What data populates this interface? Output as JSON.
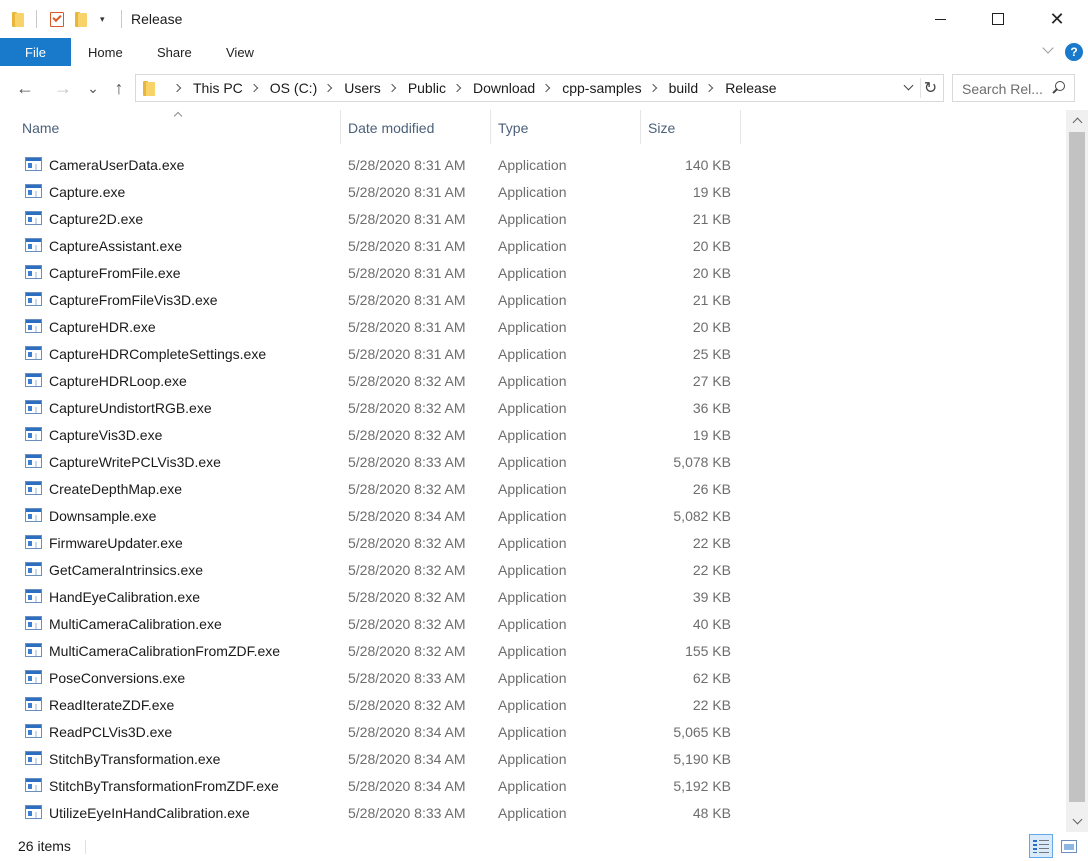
{
  "window": {
    "title": "Release"
  },
  "quick_access": {
    "icons": [
      "folder-icon",
      "properties-icon",
      "new-folder-icon",
      "customize-dropdown-icon"
    ],
    "dropdown_glyph": "▾"
  },
  "window_controls": {
    "close_glyph": "✕"
  },
  "ribbon": {
    "tabs": [
      {
        "label": "File"
      },
      {
        "label": "Home"
      },
      {
        "label": "Share"
      },
      {
        "label": "View"
      }
    ],
    "help_glyph": "?",
    "accent_color": "#1979ca"
  },
  "navigation": {
    "back_glyph": "←",
    "forward_glyph": "→",
    "recent_glyph": "⌄",
    "up_glyph": "↑",
    "breadcrumbs": [
      "This PC",
      "OS (C:)",
      "Users",
      "Public",
      "Download",
      "cpp-samples",
      "build",
      "Release"
    ],
    "refresh_glyph": "↻",
    "search_placeholder": "Search Rel..."
  },
  "columns": {
    "name": "Name",
    "date": "Date modified",
    "type": "Type",
    "size": "Size",
    "sorted_by": "Name"
  },
  "files": [
    {
      "name": "CameraUserData.exe",
      "date": "5/28/2020 8:31 AM",
      "type": "Application",
      "size": "140 KB"
    },
    {
      "name": "Capture.exe",
      "date": "5/28/2020 8:31 AM",
      "type": "Application",
      "size": "19 KB"
    },
    {
      "name": "Capture2D.exe",
      "date": "5/28/2020 8:31 AM",
      "type": "Application",
      "size": "21 KB"
    },
    {
      "name": "CaptureAssistant.exe",
      "date": "5/28/2020 8:31 AM",
      "type": "Application",
      "size": "20 KB"
    },
    {
      "name": "CaptureFromFile.exe",
      "date": "5/28/2020 8:31 AM",
      "type": "Application",
      "size": "20 KB"
    },
    {
      "name": "CaptureFromFileVis3D.exe",
      "date": "5/28/2020 8:31 AM",
      "type": "Application",
      "size": "21 KB"
    },
    {
      "name": "CaptureHDR.exe",
      "date": "5/28/2020 8:31 AM",
      "type": "Application",
      "size": "20 KB"
    },
    {
      "name": "CaptureHDRCompleteSettings.exe",
      "date": "5/28/2020 8:31 AM",
      "type": "Application",
      "size": "25 KB"
    },
    {
      "name": "CaptureHDRLoop.exe",
      "date": "5/28/2020 8:32 AM",
      "type": "Application",
      "size": "27 KB"
    },
    {
      "name": "CaptureUndistortRGB.exe",
      "date": "5/28/2020 8:32 AM",
      "type": "Application",
      "size": "36 KB"
    },
    {
      "name": "CaptureVis3D.exe",
      "date": "5/28/2020 8:32 AM",
      "type": "Application",
      "size": "19 KB"
    },
    {
      "name": "CaptureWritePCLVis3D.exe",
      "date": "5/28/2020 8:33 AM",
      "type": "Application",
      "size": "5,078 KB"
    },
    {
      "name": "CreateDepthMap.exe",
      "date": "5/28/2020 8:32 AM",
      "type": "Application",
      "size": "26 KB"
    },
    {
      "name": "Downsample.exe",
      "date": "5/28/2020 8:34 AM",
      "type": "Application",
      "size": "5,082 KB"
    },
    {
      "name": "FirmwareUpdater.exe",
      "date": "5/28/2020 8:32 AM",
      "type": "Application",
      "size": "22 KB"
    },
    {
      "name": "GetCameraIntrinsics.exe",
      "date": "5/28/2020 8:32 AM",
      "type": "Application",
      "size": "22 KB"
    },
    {
      "name": "HandEyeCalibration.exe",
      "date": "5/28/2020 8:32 AM",
      "type": "Application",
      "size": "39 KB"
    },
    {
      "name": "MultiCameraCalibration.exe",
      "date": "5/28/2020 8:32 AM",
      "type": "Application",
      "size": "40 KB"
    },
    {
      "name": "MultiCameraCalibrationFromZDF.exe",
      "date": "5/28/2020 8:32 AM",
      "type": "Application",
      "size": "155 KB"
    },
    {
      "name": "PoseConversions.exe",
      "date": "5/28/2020 8:33 AM",
      "type": "Application",
      "size": "62 KB"
    },
    {
      "name": "ReadIterateZDF.exe",
      "date": "5/28/2020 8:32 AM",
      "type": "Application",
      "size": "22 KB"
    },
    {
      "name": "ReadPCLVis3D.exe",
      "date": "5/28/2020 8:34 AM",
      "type": "Application",
      "size": "5,065 KB"
    },
    {
      "name": "StitchByTransformation.exe",
      "date": "5/28/2020 8:34 AM",
      "type": "Application",
      "size": "5,190 KB"
    },
    {
      "name": "StitchByTransformationFromZDF.exe",
      "date": "5/28/2020 8:34 AM",
      "type": "Application",
      "size": "5,192 KB"
    },
    {
      "name": "UtilizeEyeInHandCalibration.exe",
      "date": "5/28/2020 8:33 AM",
      "type": "Application",
      "size": "48 KB"
    }
  ],
  "status": {
    "item_count": "26 items",
    "active_view": "details"
  }
}
